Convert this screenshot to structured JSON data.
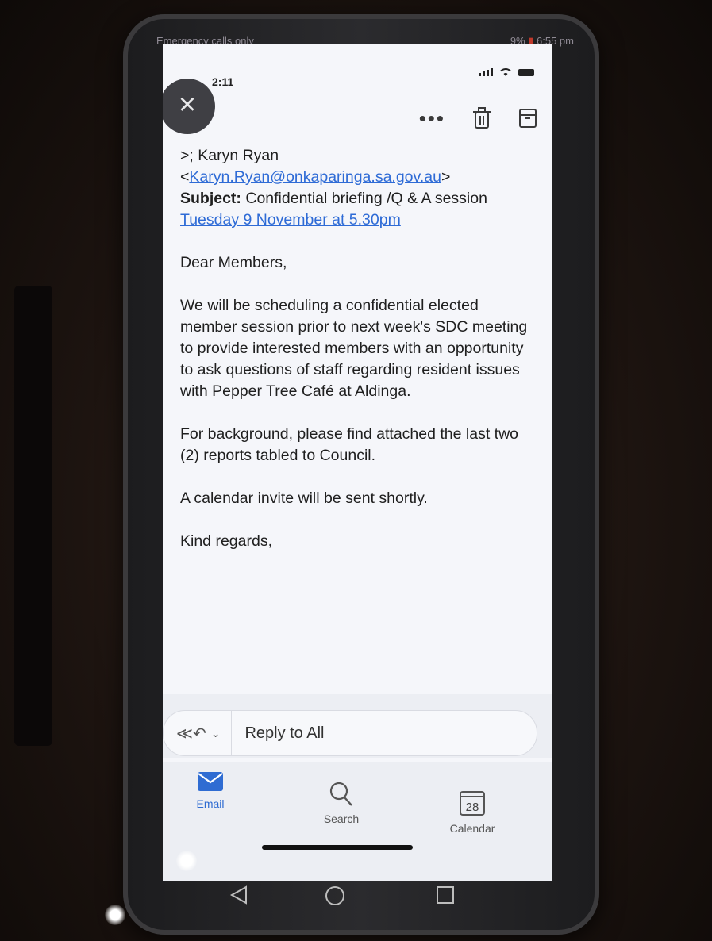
{
  "outer_status": {
    "left": "Emergency calls only",
    "right": "9%",
    "time": "6:55 pm"
  },
  "status_bar": {
    "time": "2:11"
  },
  "toolbar": {
    "close_icon": "close-icon",
    "more_icon": "more-icon",
    "delete_icon": "trash-icon",
    "archive_icon": "archive-icon"
  },
  "email": {
    "recipient_line": ">; Karyn Ryan",
    "recipient_email_open": "<",
    "recipient_email": "Karyn.Ryan@onkaparinga.sa.gov.au",
    "recipient_email_close": ">",
    "subject_label": "Subject:",
    "subject_text": "Confidential briefing /Q & A session",
    "subject_link": "Tuesday 9 November at 5.30pm",
    "greeting": "Dear Members,",
    "paragraph1": "We will be scheduling a confidential elected member session prior to next week's SDC meeting to provide interested members with an opportunity to ask questions of staff regarding resident issues with Pepper Tree Café at Aldinga.",
    "paragraph2": "For background, please find attached the last two (2) reports tabled to Council.",
    "paragraph3": "A calendar invite will be sent shortly.",
    "signoff": "Kind regards,"
  },
  "reply": {
    "label": "Reply to All"
  },
  "nav": {
    "email": "Email",
    "search": "Search",
    "calendar": "Calendar",
    "calendar_day": "28"
  },
  "colors": {
    "accent": "#2f6cd2",
    "link": "#2e6bd6",
    "screen_bg": "#f5f6fa"
  }
}
